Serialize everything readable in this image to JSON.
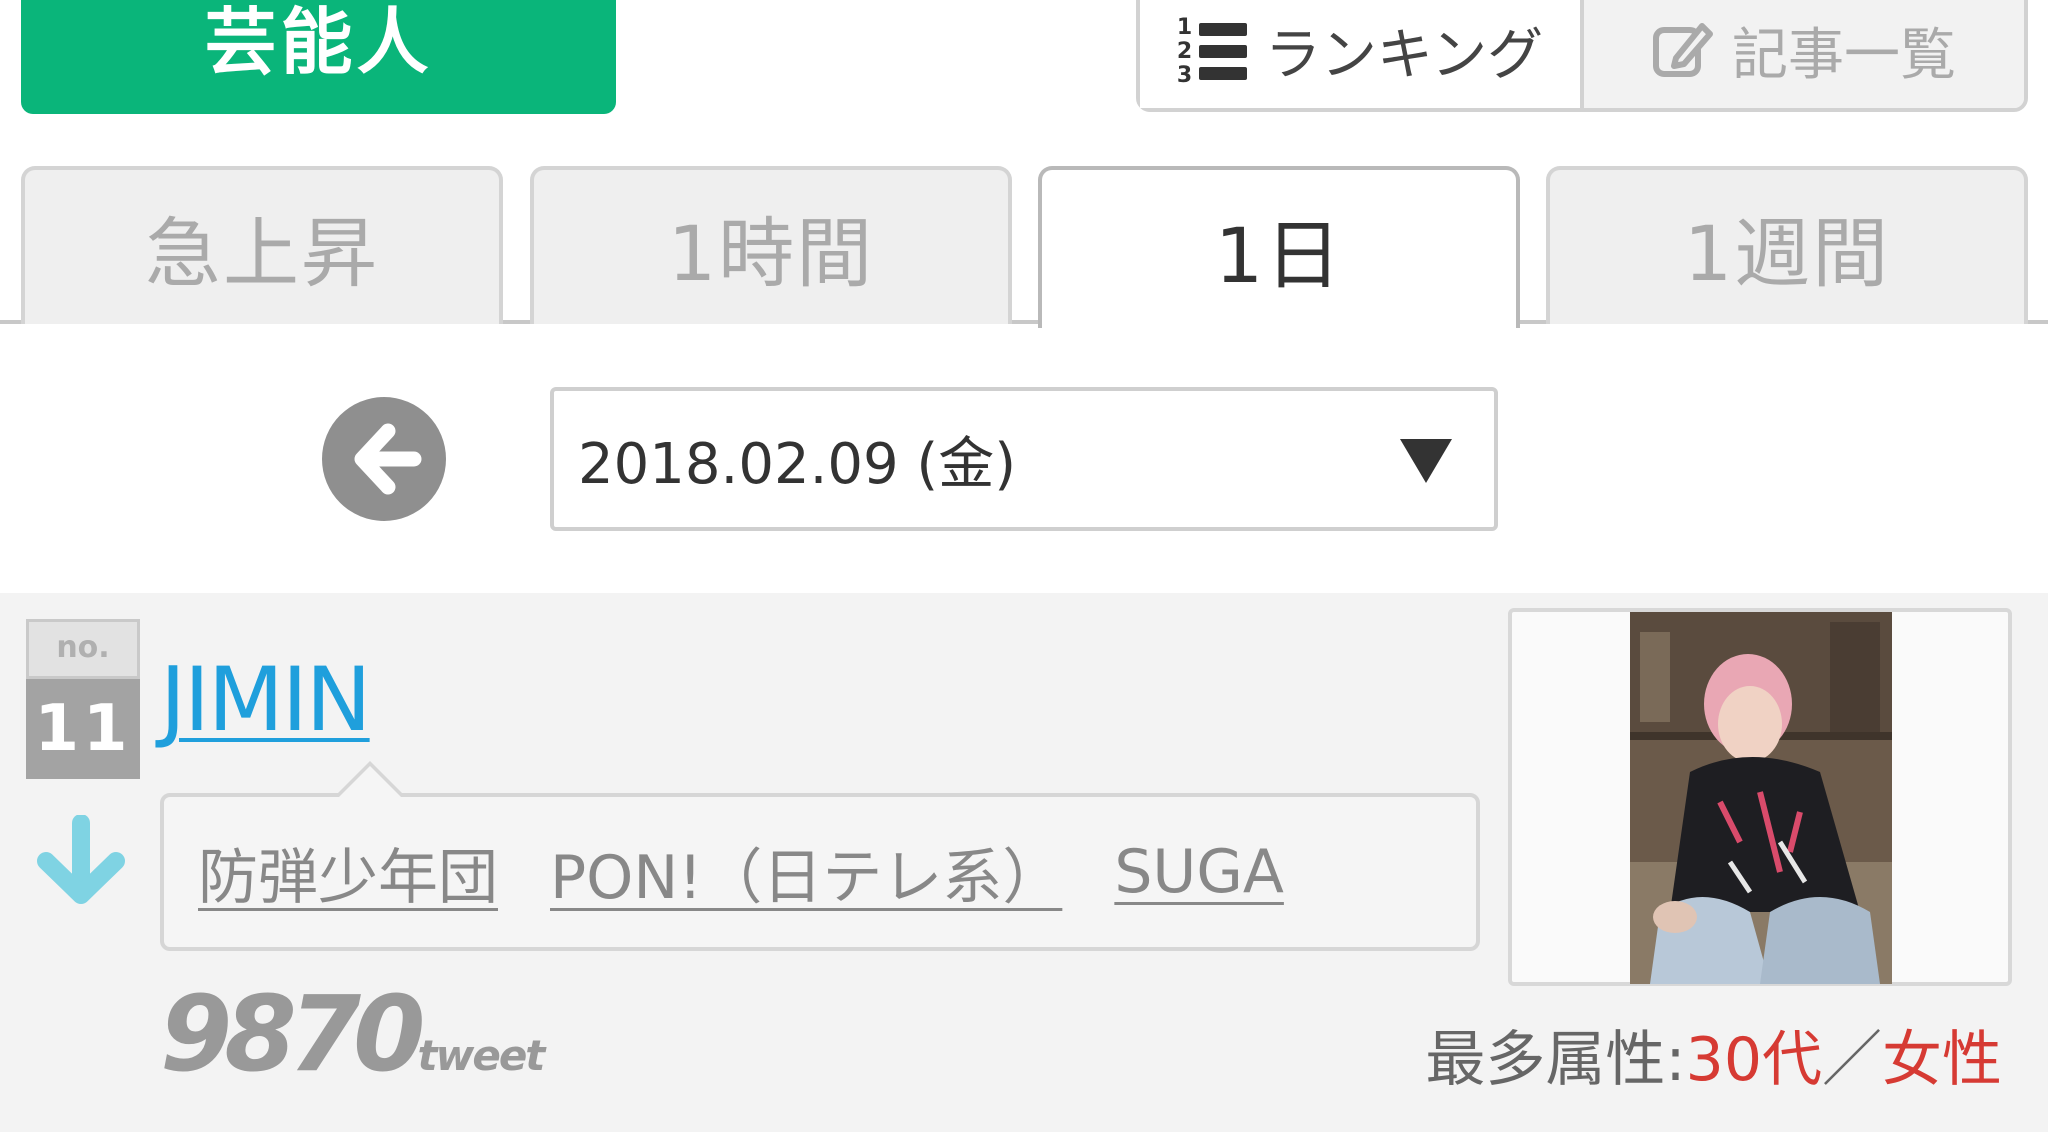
{
  "header": {
    "category_label": "芸能人",
    "tabs": [
      {
        "label": "ランキング",
        "icon": "ranked-list-icon",
        "active": true
      },
      {
        "label": "記事一覧",
        "icon": "edit-icon",
        "active": false
      }
    ],
    "rank_icon_digits": [
      "1",
      "2",
      "3"
    ]
  },
  "period_tabs": [
    {
      "label": "急上昇",
      "active": false
    },
    {
      "label": "1時間",
      "active": false
    },
    {
      "label": "1日",
      "active": true
    },
    {
      "label": "1週間",
      "active": false
    }
  ],
  "date_nav": {
    "back_icon": "arrow-left-circle-icon",
    "selected_date": "2018.02.09 (金)",
    "dropdown_icon": "caret-down-icon"
  },
  "entry": {
    "rank_prefix": "no.",
    "rank": "11",
    "trend": "down",
    "name": "JIMIN",
    "tags": [
      "防弾少年団",
      "PON!（日テレ系）",
      "SUGA"
    ],
    "tweet_count": "9870",
    "tweet_unit": "tweet",
    "attribute_label": "最多属性:",
    "attribute_age": "30代",
    "attribute_sep": "／",
    "attribute_gender": "女性"
  },
  "colors": {
    "brand_green": "#0ab57a",
    "link_blue": "#1f9fdc",
    "trend_down": "#7fd3e3",
    "highlight_red": "#d63a33"
  }
}
